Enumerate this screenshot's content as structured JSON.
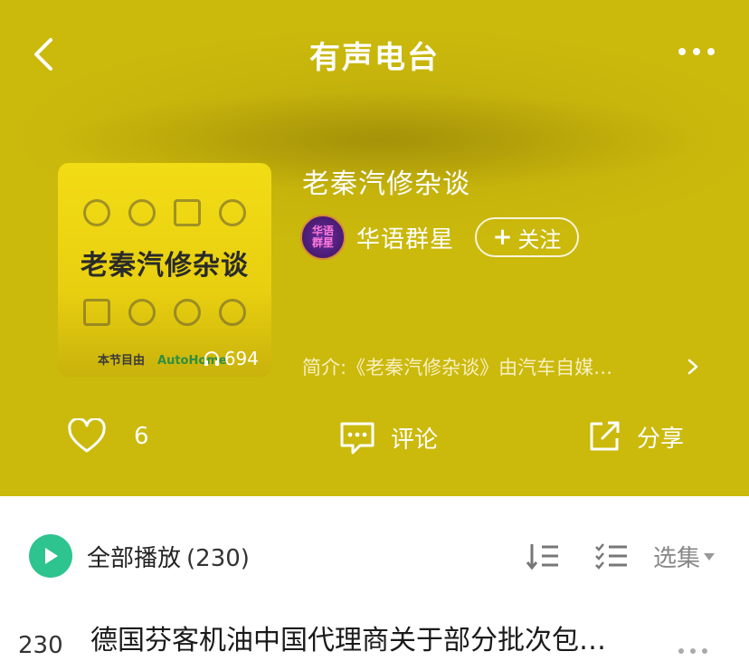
{
  "header": {
    "title": "有声电台"
  },
  "album": {
    "cover_title": "老秦汽修杂谈",
    "cover_footer_left": "本节目由",
    "cover_footer_brand": "AutoHome",
    "play_count": "694",
    "title": "老秦汽修杂谈",
    "author": {
      "avatar_text": "华语\n群星",
      "name": "华语群星"
    },
    "follow_label": "关注",
    "intro": "简介:《老秦汽修杂谈》由汽车自媒…"
  },
  "actions": {
    "like_count": "6",
    "comment_label": "评论",
    "share_label": "分享"
  },
  "list": {
    "play_all_label": "全部播放",
    "play_all_count": "(230)",
    "episodes_label": "选集"
  },
  "episodes": [
    {
      "index": "230",
      "title": "德国芬客机油中国代理商关于部分批次包…"
    }
  ],
  "colors": {
    "hero_bg": "#c6b40c",
    "accent_green": "#2ec48f"
  }
}
